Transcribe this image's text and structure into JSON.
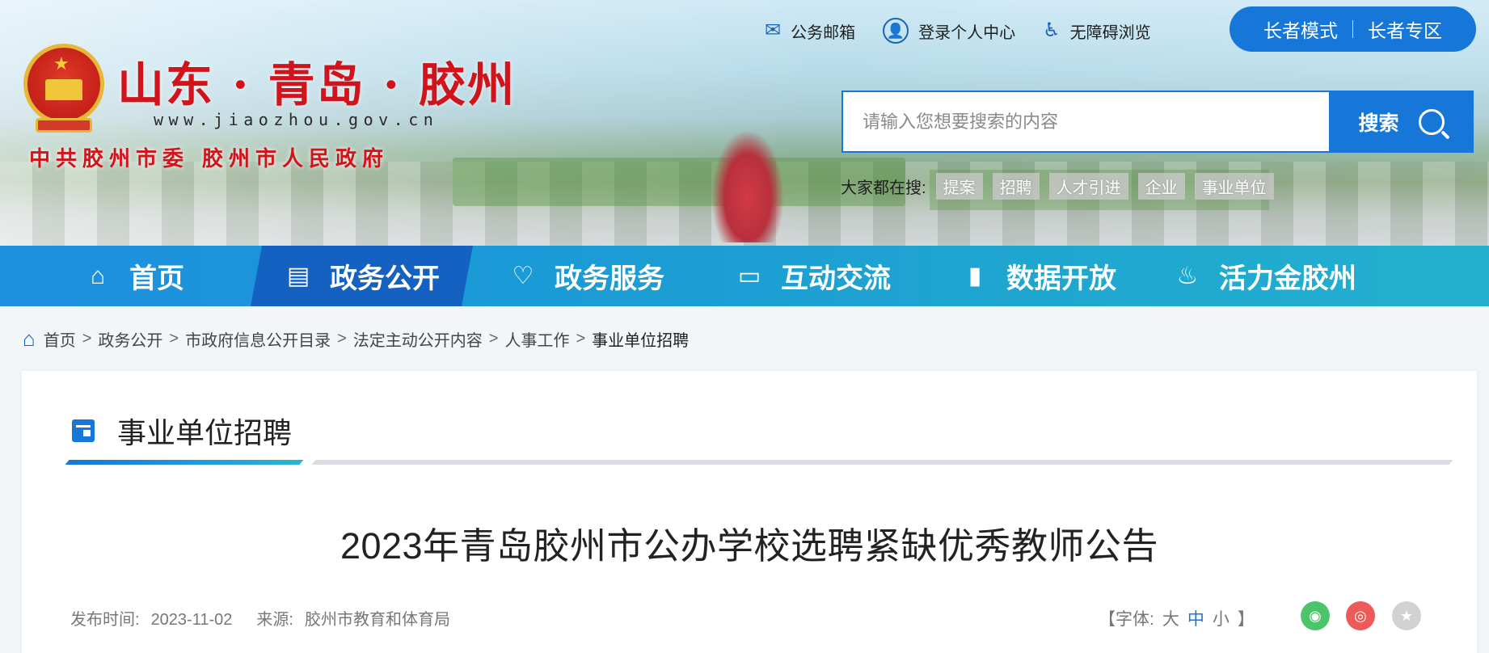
{
  "header": {
    "site_title": "山东 · 青岛 · 胶州",
    "site_url": "www.jiaozhou.gov.cn",
    "site_subtitle": "中共胶州市委  胶州市人民政府",
    "top_links": [
      {
        "label": "公务邮箱",
        "icon": "mail-icon"
      },
      {
        "label": "登录个人中心",
        "icon": "user-icon"
      },
      {
        "label": "无障碍浏览",
        "icon": "wheelchair-icon"
      }
    ],
    "elder_mode": "长者模式",
    "elder_zone": "长者专区",
    "search_placeholder": "请输入您想要搜索的内容",
    "search_button": "搜索",
    "hot_label": "大家都在搜:",
    "hot_tags": [
      "提案",
      "招聘",
      "人才引进",
      "企业",
      "事业单位"
    ]
  },
  "nav": {
    "items": [
      {
        "label": "首页",
        "icon": "home-icon"
      },
      {
        "label": "政务公开",
        "icon": "document-icon",
        "active": true
      },
      {
        "label": "政务服务",
        "icon": "heart-icon"
      },
      {
        "label": "互动交流",
        "icon": "chat-icon"
      },
      {
        "label": "数据开放",
        "icon": "bar-chart-icon"
      },
      {
        "label": "活力金胶州",
        "icon": "flame-icon"
      }
    ]
  },
  "breadcrumb": {
    "items": [
      "首页",
      "政务公开",
      "市政府信息公开目录",
      "法定主动公开内容",
      "人事工作"
    ],
    "current": "事业单位招聘",
    "separator": ">"
  },
  "article": {
    "section_title": "事业单位招聘",
    "title": "2023年青岛胶州市公办学校选聘紧缺优秀教师公告",
    "publish_label": "发布时间:",
    "publish_date": "2023-11-02",
    "source_label": "来源:",
    "source": "胶州市教育和体育局",
    "font_size": {
      "open": "【字体:",
      "large": "大",
      "medium": "中",
      "small": "小",
      "close": "】"
    },
    "share": [
      {
        "name": "wechat",
        "color": "#4cc46a"
      },
      {
        "name": "weibo",
        "color": "#ec5a5a"
      },
      {
        "name": "favorite",
        "color": "#d2d2d2"
      }
    ]
  },
  "colors": {
    "brand_blue": "#1677d9",
    "nav_active": "#1561c1",
    "title_red": "#d1141c"
  }
}
